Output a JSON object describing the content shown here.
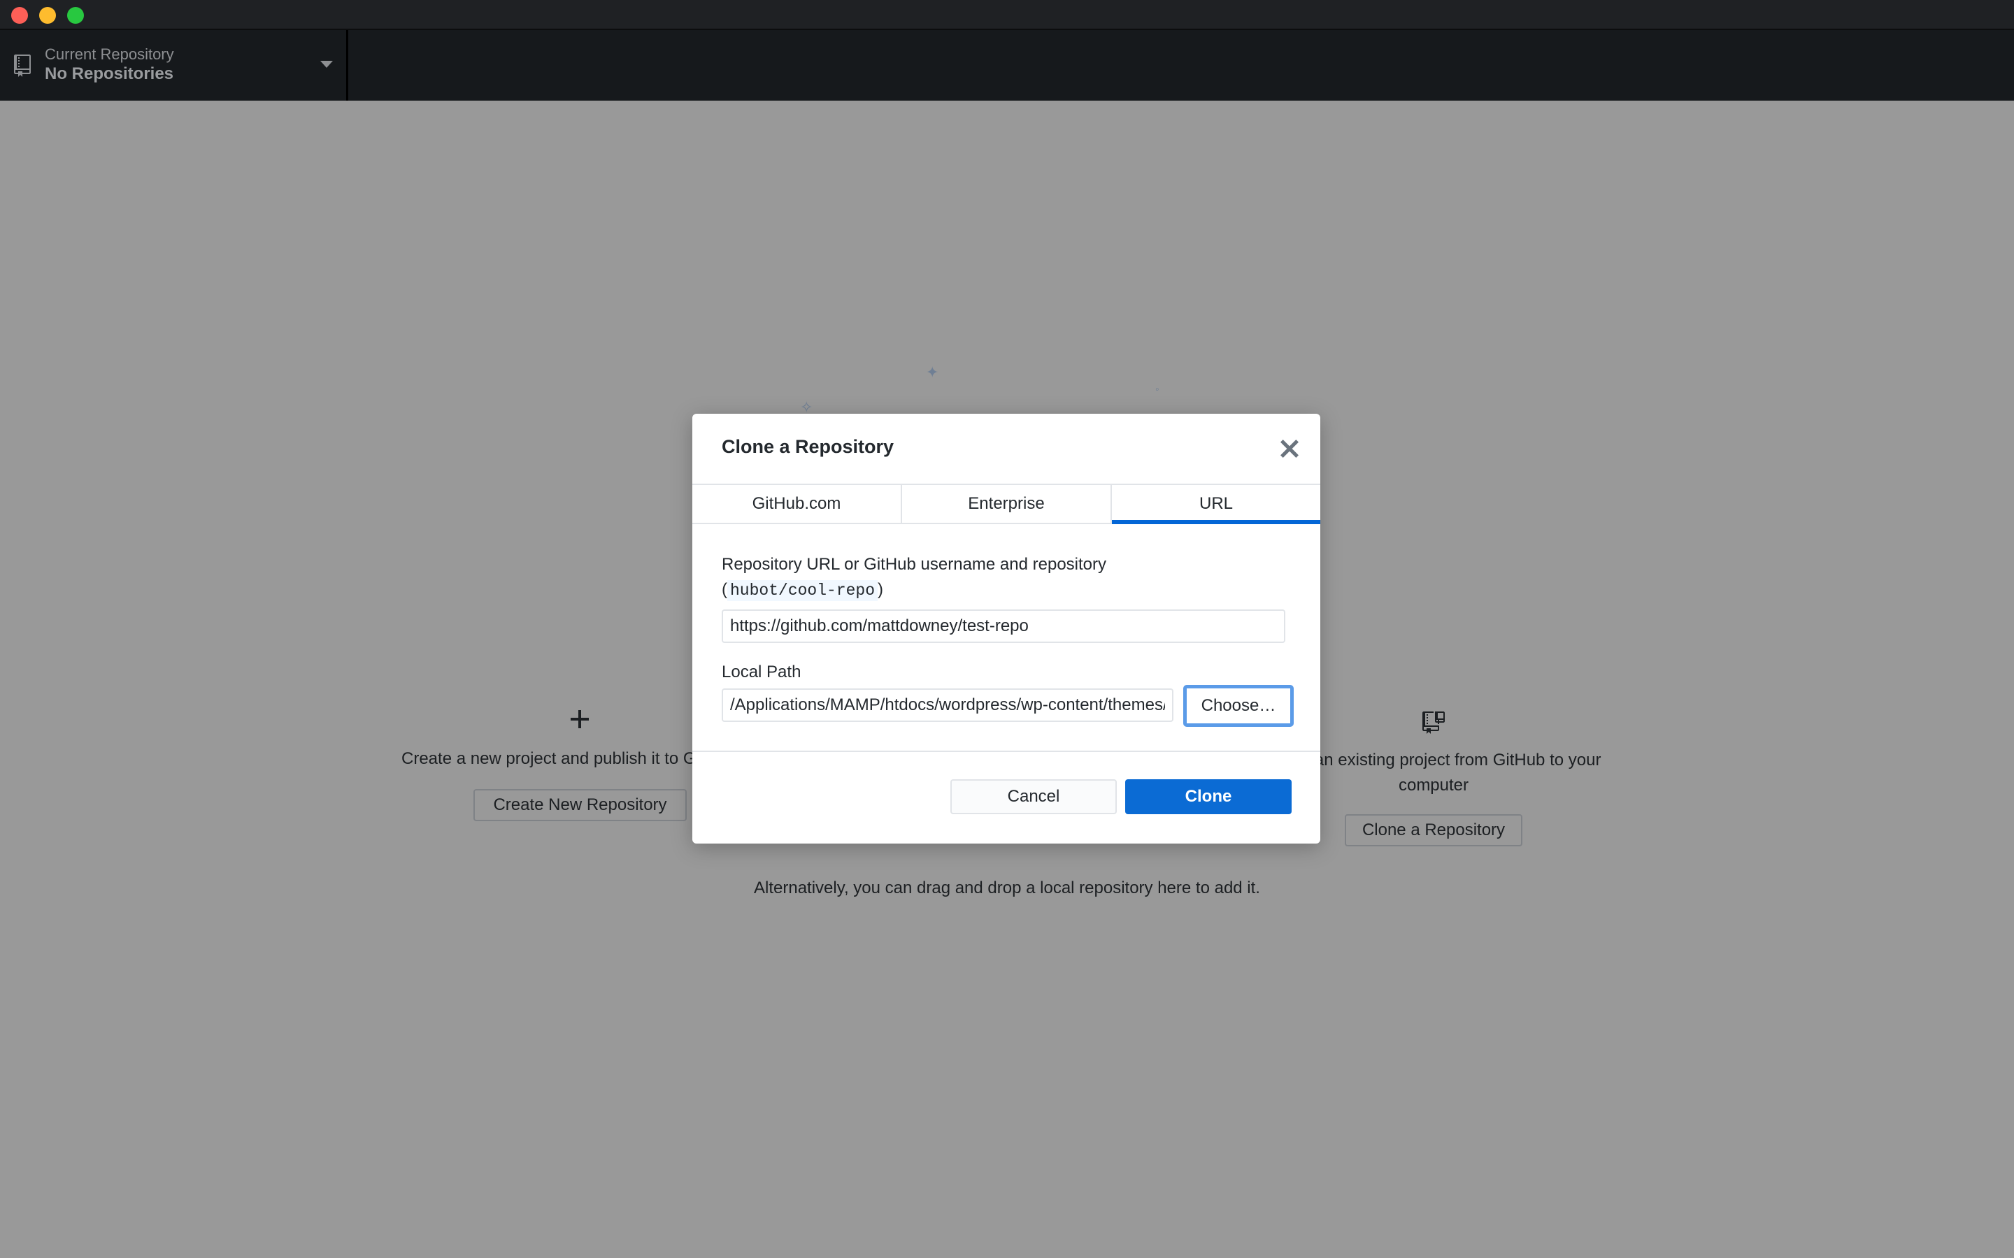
{
  "window": {
    "traffic_lights": {
      "close": "#fd5f57",
      "minimize": "#febc2e",
      "maximize": "#28c840"
    }
  },
  "toolbar": {
    "repo_label": "Current Repository",
    "repo_value": "No Repositories",
    "repo_icon": "repo-icon",
    "caret_icon": "triangle-down-icon"
  },
  "blank_slate": {
    "create": {
      "icon": "plus-icon",
      "description": "Create a new project and publish it to GitHub",
      "button": "Create New Repository"
    },
    "clone": {
      "icon": "repo-clone-icon",
      "description": "Clone an existing project from GitHub to your computer",
      "button": "Clone a Repository"
    },
    "drop_hint": "Alternatively, you can drag and drop a local repository here to add it."
  },
  "dialog": {
    "title": "Clone a Repository",
    "close_icon": "close-icon",
    "tabs": [
      {
        "label": "GitHub.com",
        "active": false
      },
      {
        "label": "Enterprise",
        "active": false
      },
      {
        "label": "URL",
        "active": true
      }
    ],
    "url_label": "Repository URL or GitHub username and repository",
    "url_hint_open": "(",
    "url_hint_code": "hubot/cool-repo",
    "url_hint_close": ")",
    "url_value": "https://github.com/mattdowney/test-repo",
    "local_path_label": "Local Path",
    "local_path_value": "/Applications/MAMP/htdocs/wordpress/wp-content/themes/test-repo",
    "choose_button": "Choose…",
    "cancel_button": "Cancel",
    "clone_button": "Clone",
    "accent_color": "#0366d6"
  }
}
